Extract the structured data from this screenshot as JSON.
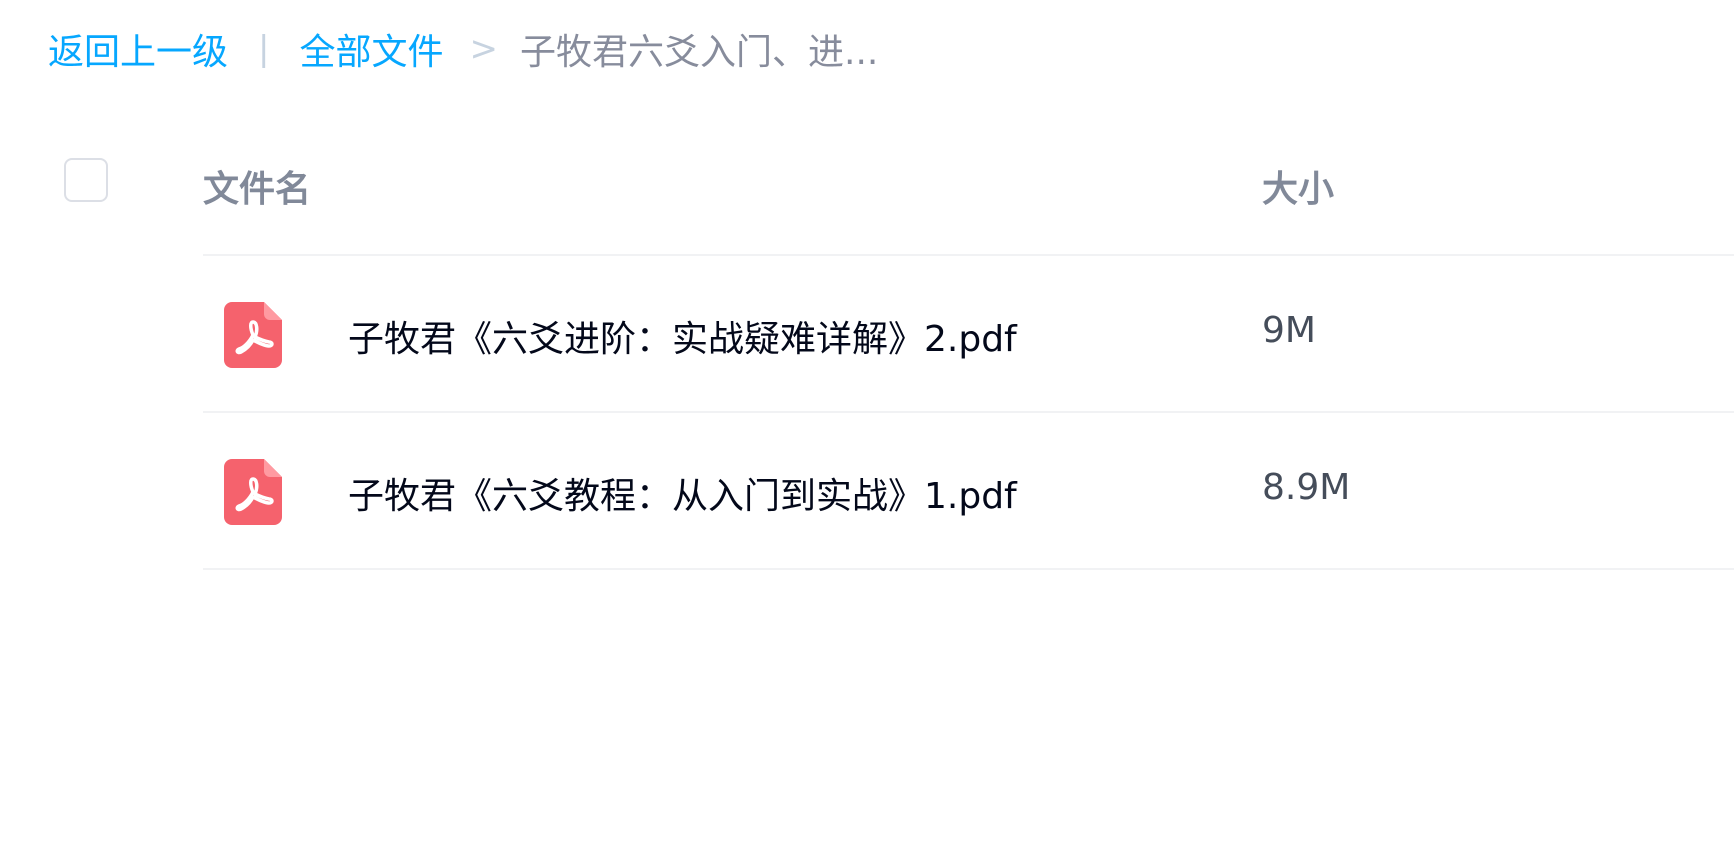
{
  "breadcrumb": {
    "back_label": "返回上一级",
    "separator": "|",
    "root_label": "全部文件",
    "arrow": ">",
    "current_label": "子牧君六爻入门、进..."
  },
  "table": {
    "headers": {
      "name": "文件名",
      "size": "大小"
    },
    "files": [
      {
        "icon": "pdf-icon",
        "name": "子牧君《六爻进阶：实战疑难详解》2.pdf",
        "size": "9M"
      },
      {
        "icon": "pdf-icon",
        "name": "子牧君《六爻教程：从入门到实战》1.pdf",
        "size": "8.9M"
      }
    ]
  },
  "colors": {
    "link": "#06a7ff",
    "pdf_icon": "#f5626d",
    "header_text": "#818999"
  }
}
